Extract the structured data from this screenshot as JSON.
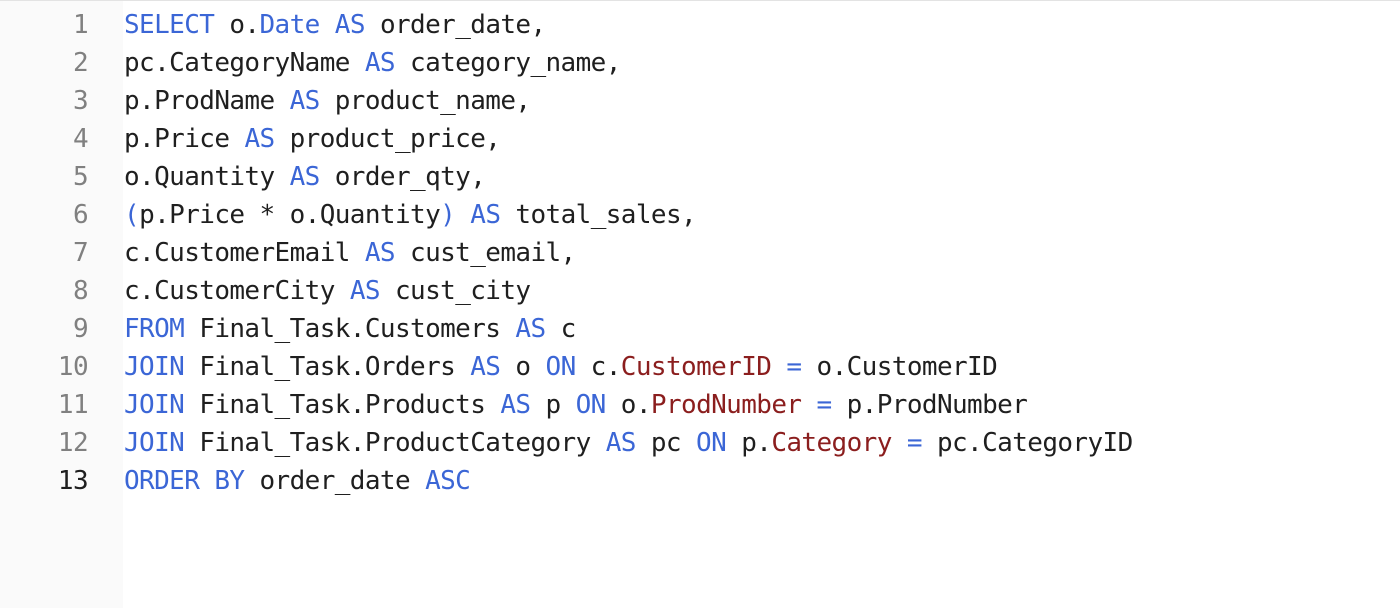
{
  "colors": {
    "keyword": "#3b66d6",
    "column_ref": "#8b1e1e",
    "plain": "#1f1f1f",
    "line_number": "#808080",
    "active_line_number": "#1f1f1f",
    "gutter_bg": "#fafafa"
  },
  "editor": {
    "active_line": 13,
    "lines": [
      {
        "n": "1",
        "tokens": [
          {
            "t": "kw",
            "v": "SELECT"
          },
          {
            "t": "plain",
            "v": " o."
          },
          {
            "t": "kw",
            "v": "Date"
          },
          {
            "t": "plain",
            "v": " "
          },
          {
            "t": "kw",
            "v": "AS"
          },
          {
            "t": "plain",
            "v": " order_date,"
          }
        ]
      },
      {
        "n": "2",
        "tokens": [
          {
            "t": "plain",
            "v": "pc.CategoryName "
          },
          {
            "t": "kw",
            "v": "AS"
          },
          {
            "t": "plain",
            "v": " category_name,"
          }
        ]
      },
      {
        "n": "3",
        "tokens": [
          {
            "t": "plain",
            "v": "p.ProdName "
          },
          {
            "t": "kw",
            "v": "AS"
          },
          {
            "t": "plain",
            "v": " product_name,"
          }
        ]
      },
      {
        "n": "4",
        "tokens": [
          {
            "t": "plain",
            "v": "p.Price "
          },
          {
            "t": "kw",
            "v": "AS"
          },
          {
            "t": "plain",
            "v": " product_price,"
          }
        ]
      },
      {
        "n": "5",
        "tokens": [
          {
            "t": "plain",
            "v": "o.Quantity "
          },
          {
            "t": "kw",
            "v": "AS"
          },
          {
            "t": "plain",
            "v": " order_qty,"
          }
        ]
      },
      {
        "n": "6",
        "tokens": [
          {
            "t": "kw",
            "v": "("
          },
          {
            "t": "plain",
            "v": "p.Price * o.Quantity"
          },
          {
            "t": "kw",
            "v": ")"
          },
          {
            "t": "plain",
            "v": " "
          },
          {
            "t": "kw",
            "v": "AS"
          },
          {
            "t": "plain",
            "v": " total_sales,"
          }
        ]
      },
      {
        "n": "7",
        "tokens": [
          {
            "t": "plain",
            "v": "c.CustomerEmail "
          },
          {
            "t": "kw",
            "v": "AS"
          },
          {
            "t": "plain",
            "v": " cust_email,"
          }
        ]
      },
      {
        "n": "8",
        "tokens": [
          {
            "t": "plain",
            "v": "c.CustomerCity "
          },
          {
            "t": "kw",
            "v": "AS"
          },
          {
            "t": "plain",
            "v": " cust_city"
          }
        ]
      },
      {
        "n": "9",
        "tokens": [
          {
            "t": "kw",
            "v": "FROM"
          },
          {
            "t": "plain",
            "v": " Final_Task.Customers "
          },
          {
            "t": "kw",
            "v": "AS"
          },
          {
            "t": "plain",
            "v": " c"
          }
        ]
      },
      {
        "n": "10",
        "tokens": [
          {
            "t": "kw",
            "v": "JOIN"
          },
          {
            "t": "plain",
            "v": " Final_Task.Orders "
          },
          {
            "t": "kw",
            "v": "AS"
          },
          {
            "t": "plain",
            "v": " o "
          },
          {
            "t": "kw",
            "v": "ON"
          },
          {
            "t": "plain",
            "v": " c."
          },
          {
            "t": "col",
            "v": "CustomerID"
          },
          {
            "t": "plain",
            "v": " "
          },
          {
            "t": "op",
            "v": "="
          },
          {
            "t": "plain",
            "v": " o.CustomerID"
          }
        ]
      },
      {
        "n": "11",
        "tokens": [
          {
            "t": "kw",
            "v": "JOIN"
          },
          {
            "t": "plain",
            "v": " Final_Task.Products "
          },
          {
            "t": "kw",
            "v": "AS"
          },
          {
            "t": "plain",
            "v": " p "
          },
          {
            "t": "kw",
            "v": "ON"
          },
          {
            "t": "plain",
            "v": " o."
          },
          {
            "t": "col",
            "v": "ProdNumber"
          },
          {
            "t": "plain",
            "v": " "
          },
          {
            "t": "op",
            "v": "="
          },
          {
            "t": "plain",
            "v": " p.ProdNumber"
          }
        ]
      },
      {
        "n": "12",
        "tokens": [
          {
            "t": "kw",
            "v": "JOIN"
          },
          {
            "t": "plain",
            "v": " Final_Task.ProductCategory "
          },
          {
            "t": "kw",
            "v": "AS"
          },
          {
            "t": "plain",
            "v": " pc "
          },
          {
            "t": "kw",
            "v": "ON"
          },
          {
            "t": "plain",
            "v": " p."
          },
          {
            "t": "col",
            "v": "Category"
          },
          {
            "t": "plain",
            "v": " "
          },
          {
            "t": "op",
            "v": "="
          },
          {
            "t": "plain",
            "v": " pc.CategoryID"
          }
        ]
      },
      {
        "n": "13",
        "tokens": [
          {
            "t": "kw",
            "v": "ORDER BY"
          },
          {
            "t": "plain",
            "v": " order_date "
          },
          {
            "t": "kw",
            "v": "ASC"
          }
        ]
      }
    ]
  }
}
